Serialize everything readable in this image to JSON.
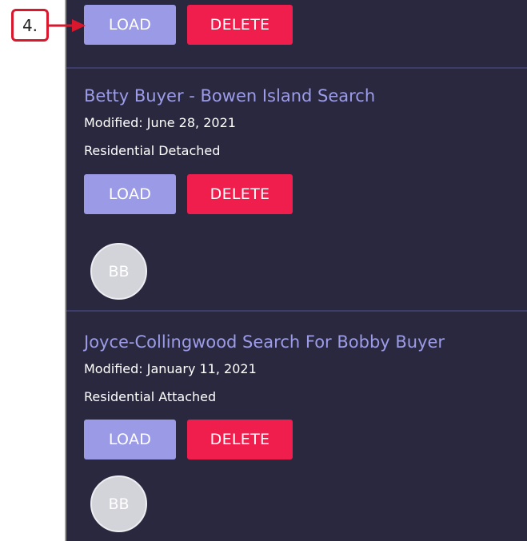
{
  "callout": {
    "step_label": "4."
  },
  "colors": {
    "panel_bg": "#29283f",
    "load": "#9a9ae6",
    "delete": "#f01e4d",
    "title": "#9c9ce8",
    "callout": "#d9182e"
  },
  "top_actions": {
    "load_label": "LOAD",
    "delete_label": "DELETE"
  },
  "searches": [
    {
      "title": "Betty Buyer - Bowen Island Search",
      "modified": "Modified: June 28, 2021",
      "property_type": "Residential Detached",
      "load_label": "LOAD",
      "delete_label": "DELETE",
      "avatar_initials": "BB"
    },
    {
      "title": "Joyce-Collingwood Search For Bobby Buyer",
      "modified": "Modified: January 11, 2021",
      "property_type": "Residential Attached",
      "load_label": "LOAD",
      "delete_label": "DELETE",
      "avatar_initials": "BB"
    }
  ]
}
